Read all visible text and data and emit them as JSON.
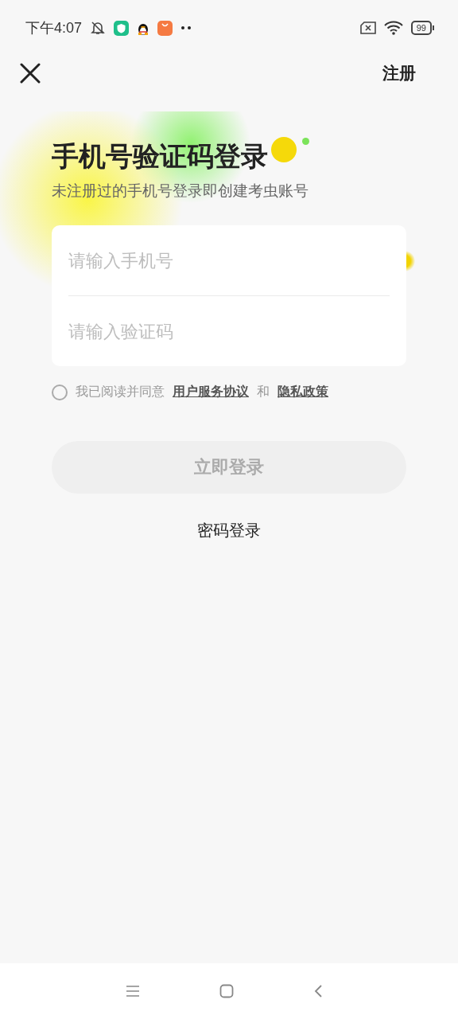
{
  "status_bar": {
    "time": "下午4:07",
    "battery": "99"
  },
  "top_bar": {
    "register": "注册"
  },
  "title": "手机号验证码登录",
  "subtitle": "未注册过的手机号登录即创建考虫账号",
  "form": {
    "fields": [
      {
        "placeholder": "请输入手机号"
      },
      {
        "placeholder": "请输入验证码"
      }
    ]
  },
  "agreement": {
    "checked": false,
    "text": "我已阅读并同意",
    "links": [
      "用户服务协议",
      "隐私政策"
    ],
    "joiner": "和"
  },
  "login_button": {
    "label": "立即登录",
    "disabled": true
  },
  "password_login": "密码登录"
}
